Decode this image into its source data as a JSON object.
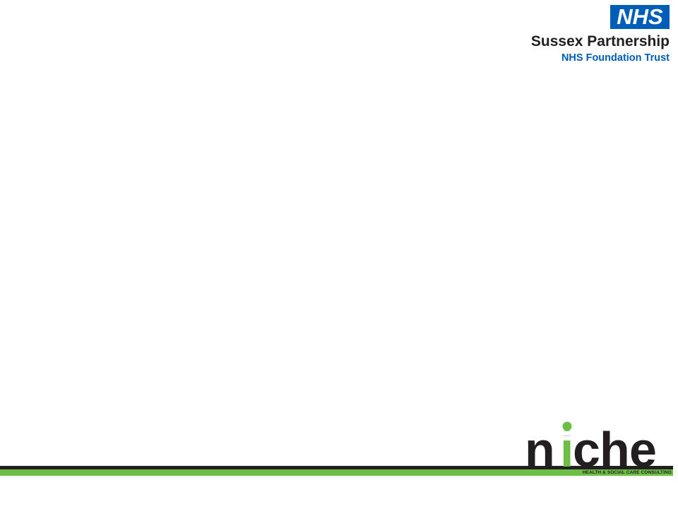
{
  "header": {
    "nhs_logo_text": "NHS",
    "trust_name": "Sussex Partnership",
    "trust_subtitle": "NHS Foundation Trust"
  },
  "footer": {
    "niche_letters": [
      "n",
      "i",
      "c",
      "h",
      "e"
    ],
    "niche_tagline": "HEALTH & SOCIAL CARE CONSULTING"
  },
  "colors": {
    "nhs_blue": "#005EB8",
    "niche_green": "#6DBE45",
    "dark": "#231F20"
  }
}
